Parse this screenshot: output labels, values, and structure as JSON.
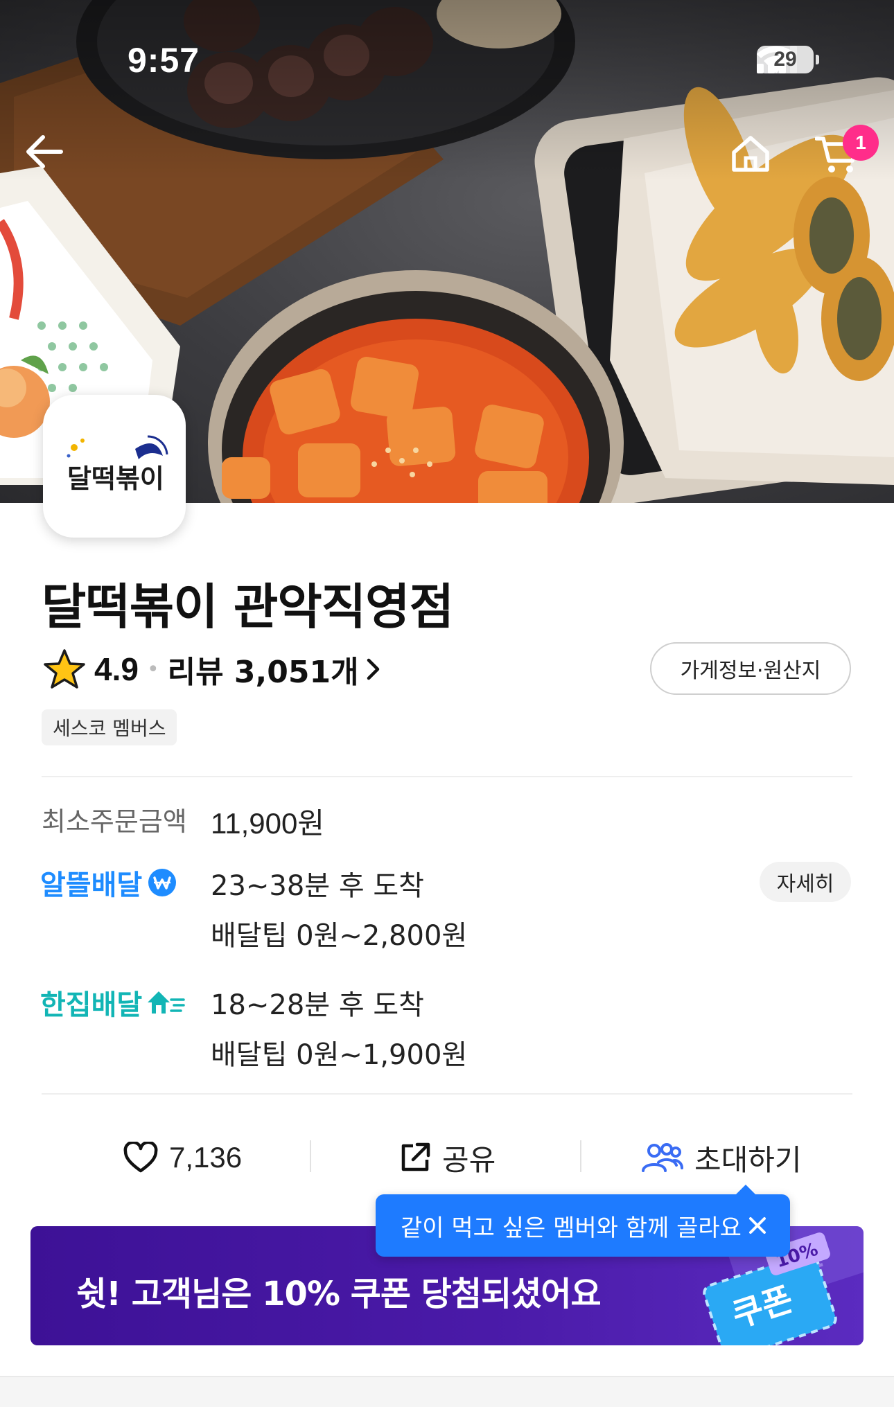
{
  "status_bar": {
    "time": "9:57",
    "battery": "29"
  },
  "header": {
    "cart_badge": "1"
  },
  "store": {
    "name": "달떡볶이 관악직영점",
    "rating": "4.9",
    "review_label": "리뷰 3,051개",
    "info_button": "가게정보·원산지",
    "member_chip": "세스코 멤버스",
    "logo_text": "달떡볶이"
  },
  "order_info": {
    "min_order_label": "최소주문금액",
    "min_order_value": "11,900원",
    "detail_button": "자세히",
    "saver": {
      "label": "알뜰배달",
      "time": "23~38분 후 도착",
      "tip": "배달팁 0원~2,800원"
    },
    "onehouse": {
      "label": "한집배달",
      "time": "18~28분 후 도착",
      "tip": "배달팁 0원~1,900원"
    }
  },
  "actions": {
    "like_count": "7,136",
    "share_label": "공유",
    "invite_label": "초대하기"
  },
  "tooltip": {
    "text": "같이 먹고 싶은 멤버와 함께 골라요"
  },
  "coupon": {
    "text": "쉿! 고객님은 10% 쿠폰 당첨되셨어요",
    "ticket_label": "쿠폰",
    "percent": "10%"
  },
  "colors": {
    "saver_blue": "#1e8cff",
    "onehouse_teal": "#12b5b5",
    "tooltip_blue": "#1e7bff",
    "coupon_purple": "#3d1196",
    "badge_pink": "#ff2d8a"
  }
}
